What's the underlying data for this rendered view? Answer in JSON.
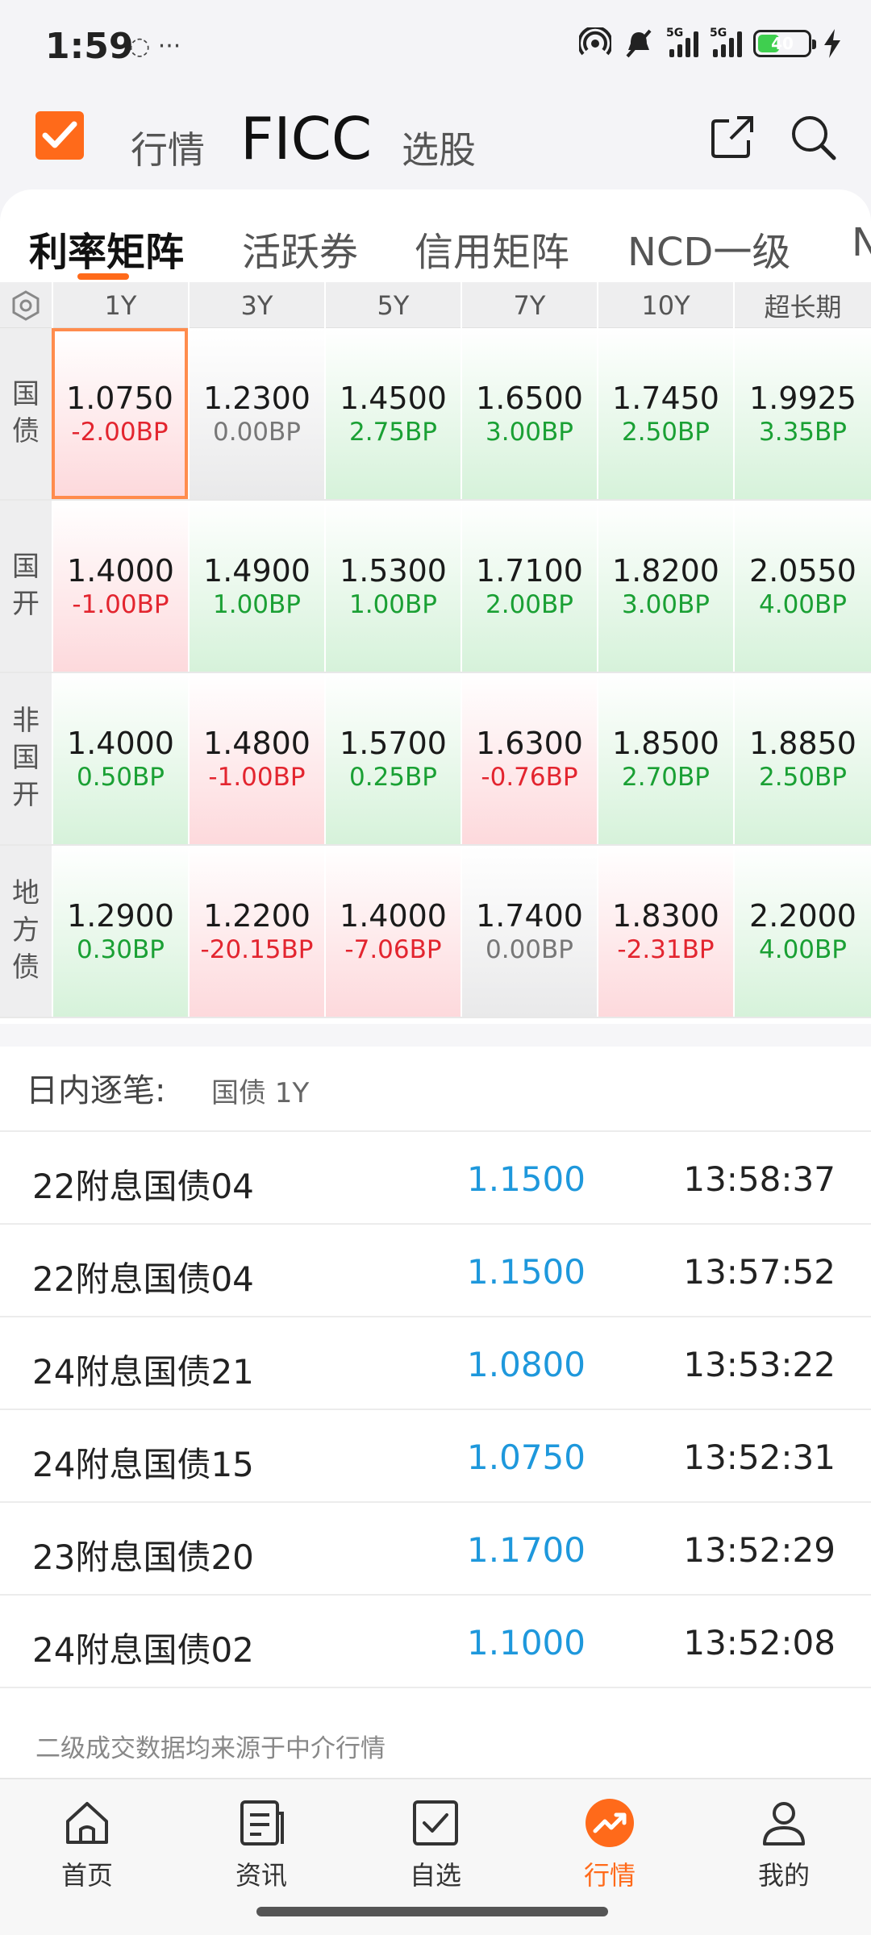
{
  "status": {
    "time": "1:59",
    "left_icons": "◌ ···",
    "signal_tag_1": "5G",
    "signal_tag_2": "5G",
    "battery": "40"
  },
  "header": {
    "tabs": [
      "行情",
      "FICC",
      "选股"
    ],
    "share_icon": "share-icon",
    "search_icon": "search-icon"
  },
  "sub_tabs": [
    "利率矩阵",
    "活跃券",
    "信用矩阵",
    "NCD一级",
    "N"
  ],
  "matrix": {
    "columns": [
      "1Y",
      "3Y",
      "5Y",
      "7Y",
      "10Y",
      "超长期"
    ],
    "rows": [
      {
        "label": [
          "国",
          "债"
        ],
        "cells": [
          {
            "rate": "1.0750",
            "chg": "-2.00BP",
            "dir": "up"
          },
          {
            "rate": "1.2300",
            "chg": "0.00BP",
            "dir": "flat"
          },
          {
            "rate": "1.4500",
            "chg": "2.75BP",
            "dir": "down"
          },
          {
            "rate": "1.6500",
            "chg": "3.00BP",
            "dir": "down"
          },
          {
            "rate": "1.7450",
            "chg": "2.50BP",
            "dir": "down"
          },
          {
            "rate": "1.9925",
            "chg": "3.35BP",
            "dir": "down"
          }
        ]
      },
      {
        "label": [
          "国",
          "开"
        ],
        "cells": [
          {
            "rate": "1.4000",
            "chg": "-1.00BP",
            "dir": "up"
          },
          {
            "rate": "1.4900",
            "chg": "1.00BP",
            "dir": "down"
          },
          {
            "rate": "1.5300",
            "chg": "1.00BP",
            "dir": "down"
          },
          {
            "rate": "1.7100",
            "chg": "2.00BP",
            "dir": "down"
          },
          {
            "rate": "1.8200",
            "chg": "3.00BP",
            "dir": "down"
          },
          {
            "rate": "2.0550",
            "chg": "4.00BP",
            "dir": "down"
          }
        ]
      },
      {
        "label": [
          "非",
          "国",
          "开"
        ],
        "cells": [
          {
            "rate": "1.4000",
            "chg": "0.50BP",
            "dir": "down"
          },
          {
            "rate": "1.4800",
            "chg": "-1.00BP",
            "dir": "up"
          },
          {
            "rate": "1.5700",
            "chg": "0.25BP",
            "dir": "down"
          },
          {
            "rate": "1.6300",
            "chg": "-0.76BP",
            "dir": "up"
          },
          {
            "rate": "1.8500",
            "chg": "2.70BP",
            "dir": "down"
          },
          {
            "rate": "1.8850",
            "chg": "2.50BP",
            "dir": "down"
          }
        ]
      },
      {
        "label": [
          "地",
          "方",
          "债"
        ],
        "cells": [
          {
            "rate": "1.2900",
            "chg": "0.30BP",
            "dir": "down"
          },
          {
            "rate": "1.2200",
            "chg": "-20.15BP",
            "dir": "up"
          },
          {
            "rate": "1.4000",
            "chg": "-7.06BP",
            "dir": "up"
          },
          {
            "rate": "1.7400",
            "chg": "0.00BP",
            "dir": "flat"
          },
          {
            "rate": "1.8300",
            "chg": "-2.31BP",
            "dir": "up"
          },
          {
            "rate": "2.2000",
            "chg": "4.00BP",
            "dir": "down"
          }
        ]
      }
    ]
  },
  "intraday": {
    "title": "日内逐笔:",
    "subtitle": "国债 1Y",
    "rows": [
      {
        "name": "22附息国债04",
        "yield": "1.1500",
        "time": "13:58:37"
      },
      {
        "name": "22附息国债04",
        "yield": "1.1500",
        "time": "13:57:52"
      },
      {
        "name": "24附息国债21",
        "yield": "1.0800",
        "time": "13:53:22"
      },
      {
        "name": "24附息国债15",
        "yield": "1.0750",
        "time": "13:52:31"
      },
      {
        "name": "23附息国债20",
        "yield": "1.1700",
        "time": "13:52:29"
      },
      {
        "name": "24附息国债02",
        "yield": "1.1000",
        "time": "13:52:08"
      }
    ],
    "footnote": "二级成交数据均来源于中介行情"
  },
  "nav": [
    {
      "label": "首页",
      "icon": "home-icon"
    },
    {
      "label": "资讯",
      "icon": "news-icon"
    },
    {
      "label": "自选",
      "icon": "watchlist-icon"
    },
    {
      "label": "行情",
      "icon": "market-icon"
    },
    {
      "label": "我的",
      "icon": "profile-icon"
    }
  ],
  "colors": {
    "accent": "#ff6a1a",
    "up": "#e3252f",
    "down": "#1aa034",
    "yield": "#1e98dc"
  }
}
